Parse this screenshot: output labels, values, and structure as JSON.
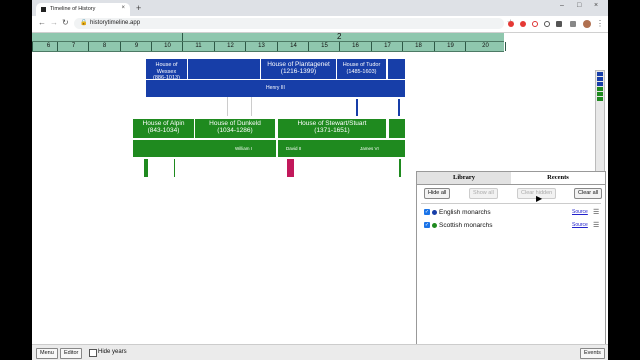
{
  "browser": {
    "tab_title": "Timeline of History",
    "url": "historytimeline.app",
    "new_tab_symbol": "+",
    "tab_close_symbol": "×",
    "window_controls": [
      "–",
      "□",
      "×"
    ],
    "nav_icons": [
      "back-arrow-icon",
      "forward-arrow-icon",
      "reload-icon"
    ]
  },
  "timeline": {
    "scale_label": "2",
    "ticks": [
      "6",
      "7",
      "8",
      "9",
      "10",
      "11",
      "12",
      "13",
      "14",
      "15",
      "16",
      "17",
      "18",
      "19",
      "20"
    ],
    "english": {
      "wessex_name": "House of Wessex",
      "wessex_years": "(886-1013)",
      "plantagenet_name": "House of Plantagenet",
      "plantagenet_years": "(1216-1399)",
      "tudor_name": "House of Tudor",
      "tudor_years": "(1485-1603)",
      "monarch_label": "Henry III"
    },
    "scottish": {
      "alpin_name": "House of Alpin",
      "alpin_years": "(843-1034)",
      "dunkeld_name": "House of Dunkeld",
      "dunkeld_years": "(1034-1286)",
      "stewart_name": "House of Stewart/Stuart",
      "stewart_years": "(1371-1651)",
      "monarch_william": "William I",
      "monarch_david": "David II",
      "monarch_james": "James VI"
    },
    "colors": {
      "english": "#173ea8",
      "scottish": "#1f8a1f",
      "highlight": "#c2185b",
      "scale": "#8fc7ae"
    }
  },
  "panel": {
    "tabs": [
      "Library",
      "Recents"
    ],
    "active_tab": "Recents",
    "buttons": {
      "hide_all": "Hide all",
      "show_all": "Show all",
      "clear_hidden": "Clear hidden",
      "clear_all": "Clear all"
    },
    "lists": [
      {
        "name": "English monarchs",
        "color": "#173ea8",
        "checked": true,
        "source": "Source"
      },
      {
        "name": "Scottish monarchs",
        "color": "#1f8a1f",
        "checked": true,
        "source": "Source"
      }
    ]
  },
  "bottom": {
    "menu": "Menu",
    "editor": "Editor",
    "hide_years": "Hide years",
    "events": "Events"
  }
}
